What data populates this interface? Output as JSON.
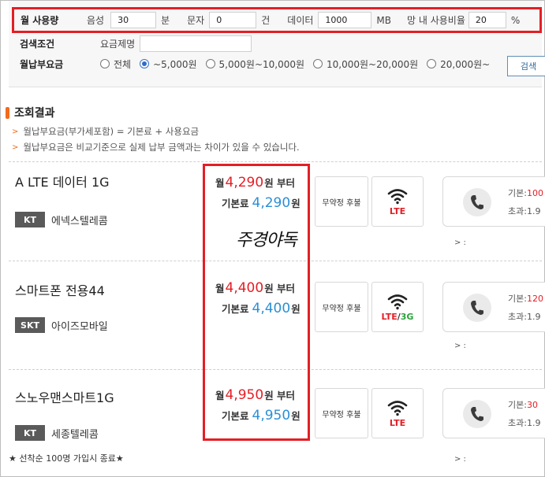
{
  "search": {
    "usage_label": "월 사용량",
    "voice_label": "음성",
    "voice_value": "30",
    "voice_unit": "분",
    "sms_label": "문자",
    "sms_value": "0",
    "sms_unit": "건",
    "data_label": "데이터",
    "data_value": "1000",
    "data_unit": "MB",
    "ratio_label": "망 내 사용비율",
    "ratio_value": "20",
    "ratio_unit": "%",
    "cond_label": "검색조건",
    "plan_name_label": "요금제명",
    "plan_name_value": "",
    "fee_label": "월납부요금",
    "fee_options": [
      "전체",
      "~5,000원",
      "5,000원~10,000원",
      "10,000원~20,000원",
      "20,000원~"
    ],
    "fee_selected": "~5,000원",
    "search_button": "검색"
  },
  "results": {
    "title": "조회결과",
    "notes": [
      "월납부요금(부가세포함) = 기본료 + 사용요금",
      "월납부요금은 비교기준으로 실제 납부 금액과는 차이가 있을 수 있습니다."
    ]
  },
  "plans": [
    {
      "name": "A LTE 데이터 1G",
      "carrier_tag": "KT",
      "company": "에넥스텔레콤",
      "month_prefix": "월",
      "monthly": "4,290",
      "month_suffix": "원 부터",
      "base_label": "기본료",
      "base": "4,290",
      "base_unit": "원",
      "commitment": "무약정 후불",
      "network": "LTE",
      "call_base": "기본:",
      "call_base_val": "100",
      "call_over": "초과:1.9",
      "more": "> :"
    },
    {
      "name": "스마트폰 전용44",
      "carrier_tag": "SKT",
      "company": "아이즈모바일",
      "month_prefix": "월",
      "monthly": "4,400",
      "month_suffix": "원 부터",
      "base_label": "기본료",
      "base": "4,400",
      "base_unit": "원",
      "commitment": "무약정 후불",
      "network_a": "LTE",
      "network_sep": "/",
      "network_b": "3G",
      "call_base": "기본:",
      "call_base_val": "120",
      "call_over": "초과:1.9",
      "more": "> :"
    },
    {
      "name": "스노우맨스마트1G",
      "carrier_tag": "KT",
      "company": "세종텔레콤",
      "month_prefix": "월",
      "monthly": "4,950",
      "month_suffix": "원 부터",
      "base_label": "기본료",
      "base": "4,950",
      "base_unit": "원",
      "commitment": "무약정 후불",
      "network": "LTE",
      "call_base": "기본:",
      "call_base_val": "30",
      "call_over": "초과:1.9",
      "more": "> :"
    }
  ],
  "footnote": "★ 선착순 100명 가입시 종료★",
  "watermark": "주경야독",
  "colors": {
    "highlight_frame": "#e41e25",
    "price_red": "#e41e25",
    "price_blue": "#2a8fd6",
    "accent_orange": "#f26b1d"
  }
}
